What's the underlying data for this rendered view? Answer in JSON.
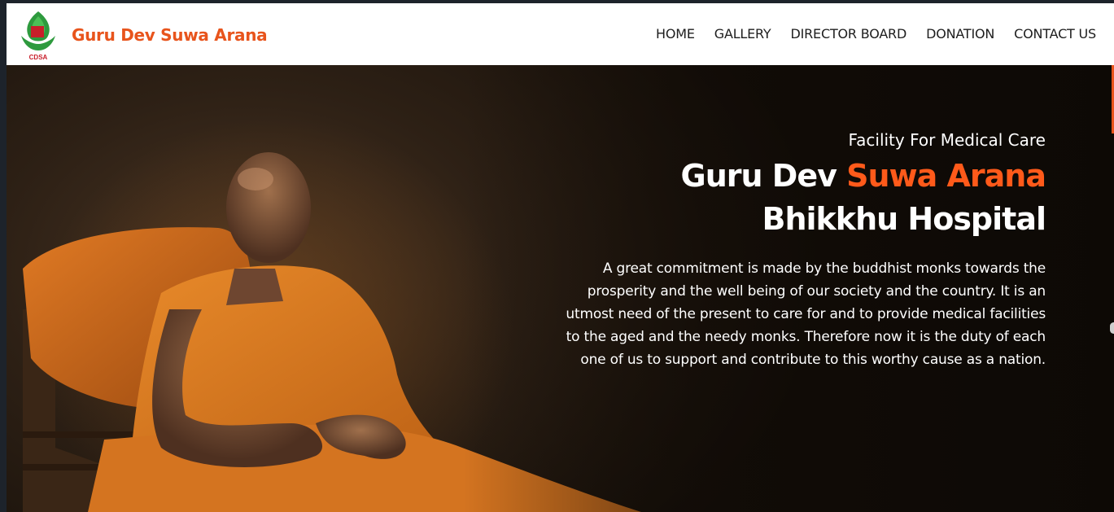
{
  "brand": {
    "name": "Guru Dev Suwa Arana",
    "logo_text": "CDSA",
    "logo_icon": "lotus-hands-logo",
    "accent_color": "#e8541c"
  },
  "nav": {
    "items": [
      {
        "label": "HOME"
      },
      {
        "label": "GALLERY"
      },
      {
        "label": "DIRECTOR BOARD"
      },
      {
        "label": "DONATION"
      },
      {
        "label": "CONTACT US"
      }
    ]
  },
  "hero": {
    "eyebrow": "Facility For Medical Care",
    "title_part1": "Guru Dev ",
    "title_accent": "Suwa Arana",
    "title_line2": "Bhikkhu Hospital",
    "accent_color": "#ff5a1a",
    "description": "A great commitment is made by the buddhist monks towards the prosperity and the well being of our society and the country. It is an utmost need of the present to care for and to provide medical facilities to the aged and the needy monks. Therefore now it is the duty of each one of us to support and contribute to this worthy cause as a nation.",
    "image": "monk-resting-in-bed-photo"
  }
}
